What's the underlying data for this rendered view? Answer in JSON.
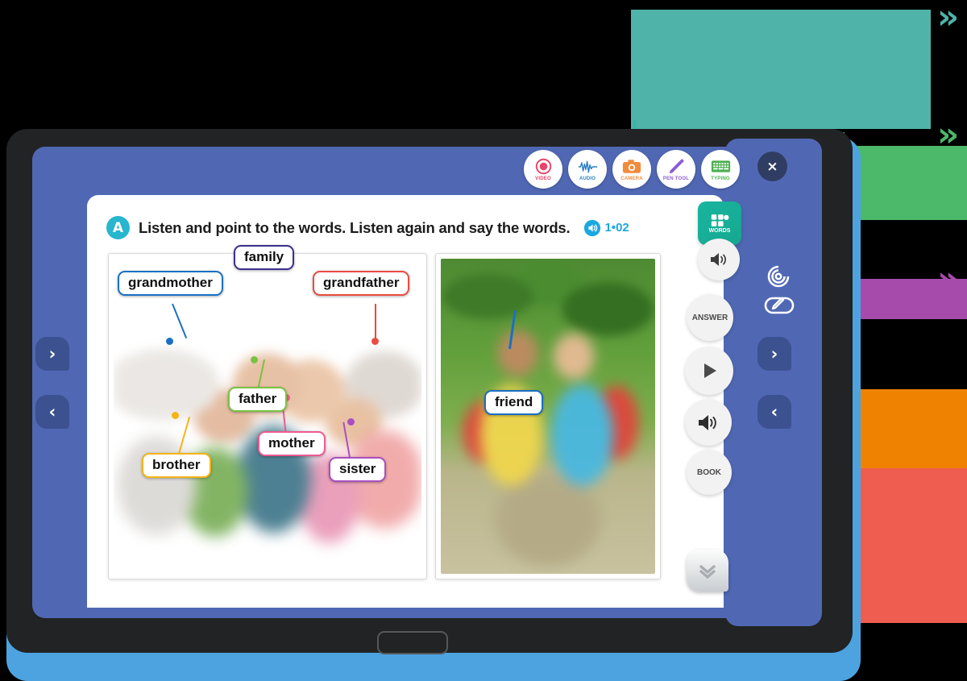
{
  "lesson": {
    "exercise_letter": "A",
    "instruction": "Listen and point to the words. Listen again and say the words.",
    "audio_track": "1•02"
  },
  "toolbar": [
    {
      "label": "VIDEO",
      "icon": "video-record-icon",
      "color": "#e8456a"
    },
    {
      "label": "AUDIO",
      "icon": "waveform-icon",
      "color": "#2b7fc4"
    },
    {
      "label": "CAMERA",
      "icon": "camera-icon",
      "color": "#f08c3c"
    },
    {
      "label": "PEN TOOL",
      "icon": "pencil-icon",
      "color": "#8b5cd6"
    },
    {
      "label": "TYPING",
      "icon": "keyboard-icon",
      "color": "#4caf50"
    }
  ],
  "family_photo": {
    "labels": [
      {
        "text": "family",
        "color": "#3b2f8f"
      },
      {
        "text": "grandmother",
        "color": "#1a6fc4"
      },
      {
        "text": "grandfather",
        "color": "#ea4b42"
      },
      {
        "text": "father",
        "color": "#7ac143"
      },
      {
        "text": "mother",
        "color": "#ee5a92"
      },
      {
        "text": "brother",
        "color": "#f5b417"
      },
      {
        "text": "sister",
        "color": "#a94fc0"
      }
    ]
  },
  "friend_photo": {
    "labels": [
      {
        "text": "friend",
        "color": "#1a6fc4"
      }
    ]
  },
  "side_tools": [
    {
      "label": "WORDS",
      "icon": "words-blocks-icon",
      "type": "badge"
    },
    {
      "label": "",
      "icon": "speaker-small-icon",
      "type": "circle"
    },
    {
      "label": "ANSWER",
      "icon": "answer-text-icon",
      "type": "circle"
    },
    {
      "label": "",
      "icon": "play-icon",
      "type": "circle"
    },
    {
      "label": "",
      "icon": "speaker-icon",
      "type": "circle"
    },
    {
      "label": "BOOK",
      "icon": "book-text-icon",
      "type": "circle"
    }
  ],
  "nav": {
    "next_label": "›",
    "prev_label": "‹",
    "close_label": "×",
    "expand_icon": "chevron-double-down-icon"
  },
  "outside_icons": [
    {
      "icon": "target-spiral-icon"
    },
    {
      "icon": "eraser-pencil-icon"
    }
  ],
  "callouts": [
    {
      "name": "teal-callout",
      "color": "#4fb3aa",
      "chevron": "»"
    },
    {
      "name": "green-callout",
      "color": "#4cb86a",
      "chevron": "»"
    },
    {
      "name": "purple-callout",
      "color": "#a64bab",
      "chevron": "»"
    },
    {
      "name": "orange-callout",
      "color": "#ef8200",
      "chevron": "»"
    },
    {
      "name": "red-callout",
      "color": "#ef5d51",
      "chevron": "»"
    }
  ],
  "theme": {
    "screen_blue": "#5068b4",
    "tablet_dark": "#222324",
    "edge_blue": "#4da3e0",
    "nav_square": "#3c5190"
  }
}
